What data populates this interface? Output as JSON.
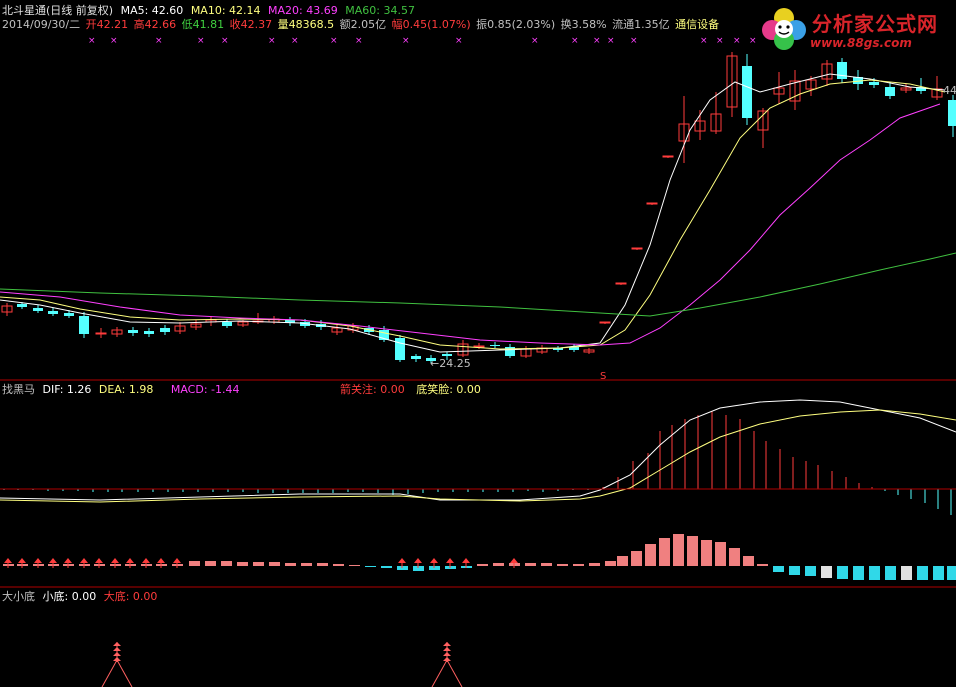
{
  "header": {
    "title": "北斗星通(日线 前复权)",
    "ma5": "MA5: 42.60",
    "ma10": "MA10: 42.14",
    "ma20": "MA20: 43.69",
    "ma60": "MA60: 34.57"
  },
  "quote": {
    "date": "2014/09/30/二",
    "open": "开42.21",
    "high": "高42.66",
    "low": "低41.81",
    "close": "收42.37",
    "volume": "量48368.5",
    "amount": "额2.05亿",
    "change": "幅0.45(1.07%)",
    "amplitude": "振0.85(2.03%)",
    "turnover": "换3.58%",
    "float": "流通1.35亿",
    "industry": "通信设备"
  },
  "annotations": {
    "low_price": "24.25",
    "right_price": "44",
    "marker": "S"
  },
  "macd_panel": {
    "name": "找黑马",
    "dif": "DIF: 1.26",
    "dea": "DEA: 1.98",
    "macd": "MACD: -1.44",
    "focus": "箭关注: 0.00",
    "smile": "底笑脸: 0.00"
  },
  "bottom_panel": {
    "name": "大小底",
    "small": "小底: 0.00",
    "big": "大底: 0.00"
  },
  "watermark": {
    "brand": "分析家公式网",
    "url": "www.88gs.com"
  },
  "colors": {
    "up": "#ff3c3c",
    "down": "#54ffff",
    "ma5": "#ffffff",
    "ma10": "#ffff80",
    "ma20": "#ff40ff",
    "ma60": "#40c040",
    "background": "#000000",
    "separator": "#b00000"
  }
}
